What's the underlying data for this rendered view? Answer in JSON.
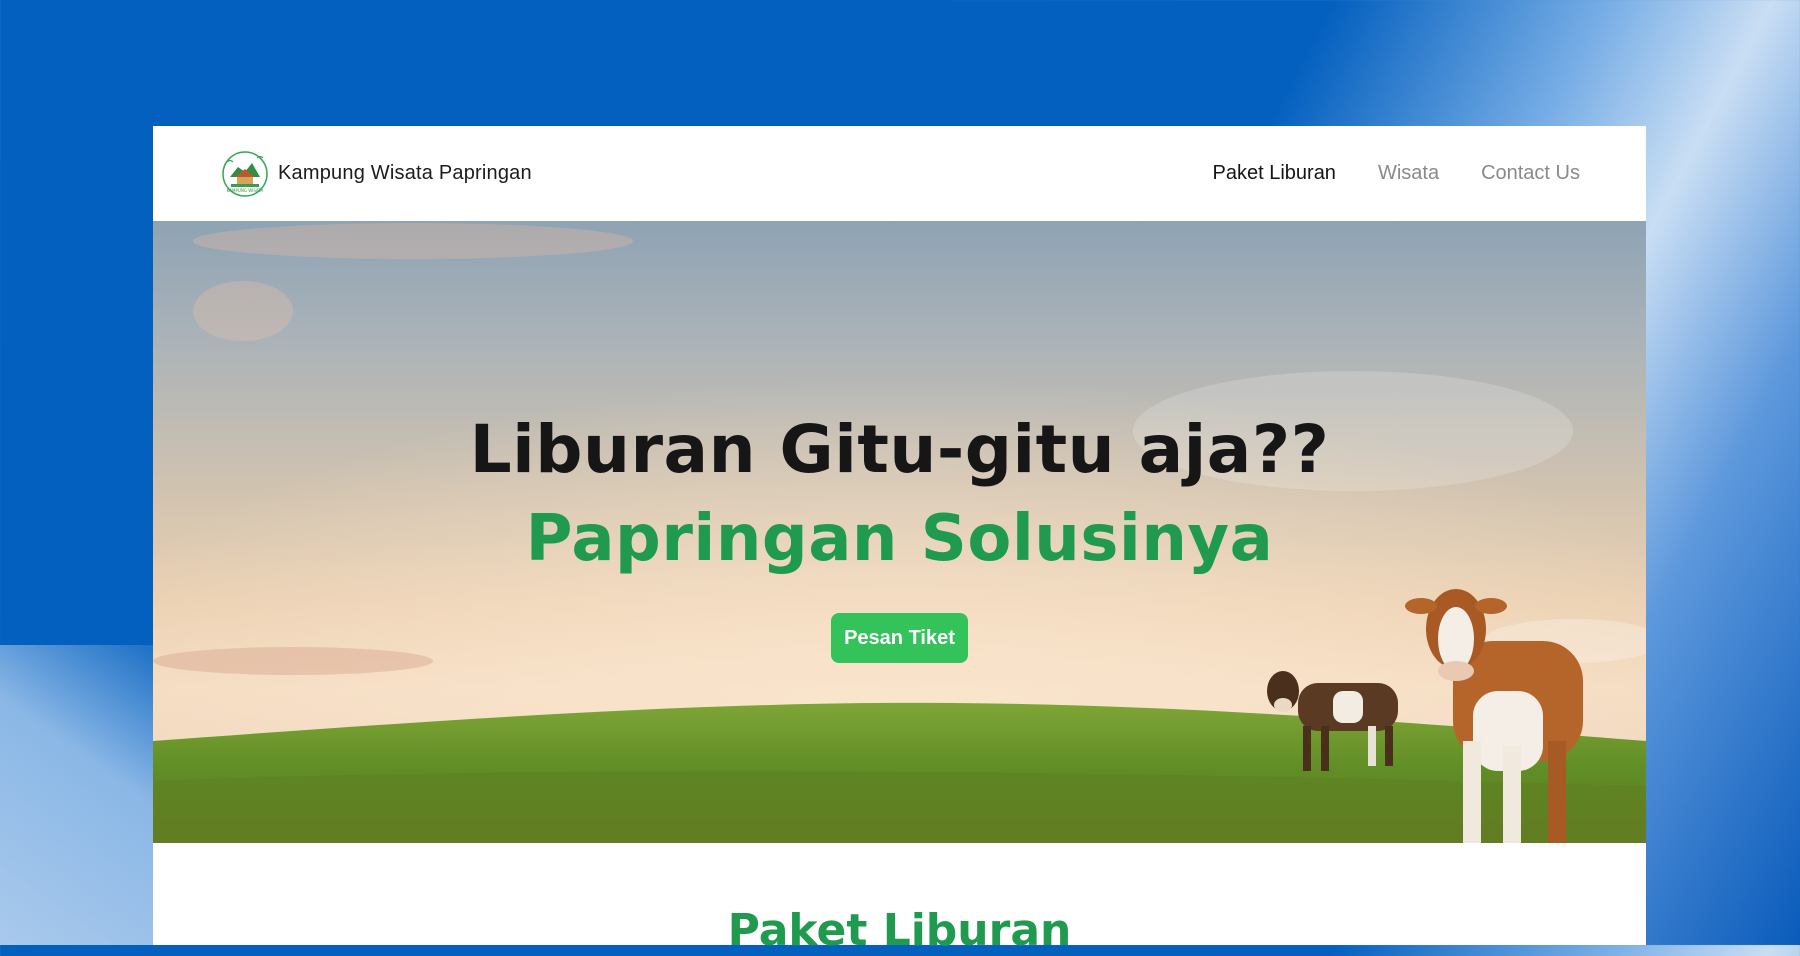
{
  "nav": {
    "brand": "Kampung Wisata Papringan",
    "links": [
      {
        "label": "Paket Liburan",
        "active": true
      },
      {
        "label": "Wisata",
        "active": false
      },
      {
        "label": "Contact Us",
        "active": false
      }
    ]
  },
  "hero": {
    "title": "Liburan Gitu-gitu aja??",
    "subtitle": "Papringan Solusinya",
    "cta_label": "Pesan Tiket"
  },
  "section": {
    "title": "Paket Liburan"
  },
  "colors": {
    "accent_green": "#1f9a4e",
    "button_green": "#34c25a",
    "background_blue": "#0460bf"
  },
  "icons": {
    "logo": "kampung-wisata-papringan-logo"
  }
}
